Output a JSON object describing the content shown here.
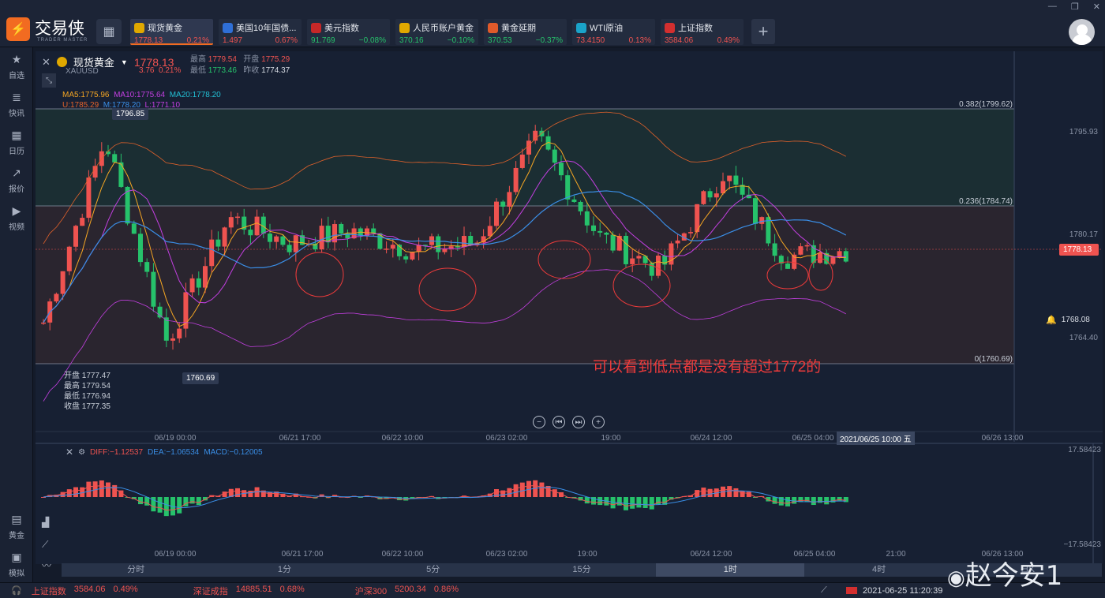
{
  "app": {
    "name": "交易侠",
    "sub": "TRADER MASTER"
  },
  "tickers": [
    {
      "name": "现货黄金",
      "price": "1778.13",
      "change": "0.21%",
      "icon": "gold-icon",
      "color": "#e0a800",
      "price_dir": "up",
      "chg_dir": "up"
    },
    {
      "name": "美国10年国债...",
      "price": "1.497",
      "change": "0.67%",
      "icon": "bond-icon",
      "color": "#2f6fd6",
      "price_dir": "up",
      "chg_dir": "up"
    },
    {
      "name": "美元指数",
      "price": "91.769",
      "change": "−0.08%",
      "icon": "us-flag-icon",
      "color": "#c62828",
      "price_dir": "dn",
      "chg_dir": "dn"
    },
    {
      "name": "人民币账户黄金",
      "price": "370.16",
      "change": "−0.10%",
      "icon": "gold-icon",
      "color": "#e0a800",
      "price_dir": "dn",
      "chg_dir": "dn"
    },
    {
      "name": "黄金延期",
      "price": "370.53",
      "change": "−0.37%",
      "icon": "gold-bar-icon",
      "color": "#e05a2a",
      "price_dir": "dn",
      "chg_dir": "dn"
    },
    {
      "name": "WTI原油",
      "price": "73.4150",
      "change": "0.13%",
      "icon": "oil-icon",
      "color": "#1aa3c9",
      "price_dir": "up",
      "chg_dir": "up"
    },
    {
      "name": "上证指数",
      "price": "3584.06",
      "change": "0.49%",
      "icon": "index-icon",
      "color": "#d32f2f",
      "price_dir": "up",
      "chg_dir": "up"
    }
  ],
  "sidebar": [
    {
      "label": "自选",
      "icon": "star-icon"
    },
    {
      "label": "快讯",
      "icon": "news-icon"
    },
    {
      "label": "日历",
      "icon": "calendar-icon"
    },
    {
      "label": "报价",
      "icon": "quote-icon"
    },
    {
      "label": "视频",
      "icon": "video-icon"
    }
  ],
  "sidebar_bottom": [
    {
      "label": "黄金",
      "icon": "gold-calc-icon"
    },
    {
      "label": "模拟",
      "icon": "wallet-icon"
    }
  ],
  "quote": {
    "name": "现货黄金",
    "code": "XAUUSD",
    "price": "1778.13",
    "chg": "3.76",
    "pct": "0.21%",
    "high_l": "最高",
    "high": "1779.54",
    "open_l": "开盘",
    "open": "1775.29",
    "low_l": "最低",
    "low": "1773.46",
    "prev_l": "昨收",
    "prev": "1774.37"
  },
  "ma": {
    "ma5": "MA5:1775.96",
    "ma10": "MA10:1775.64",
    "ma20": "MA20:1778.20",
    "u": "U:1785.29",
    "m": "M:1778.20",
    "l": "L:1771.10"
  },
  "ohlc_box": {
    "open": "开盘 1777.47",
    "high": "最高 1779.54",
    "low": "最低 1776.94",
    "close": "收盘 1777.35"
  },
  "tags": {
    "high_tag": "1796.85",
    "low_tag": "1760.69",
    "price_tag": "1778.13",
    "alert_tag": "1768.08"
  },
  "fib": [
    "0.382(1799.62)",
    "0.236(1784.74)",
    "0(1760.69)"
  ],
  "yaxis": [
    "1795.93",
    "1780.17",
    "1764.40"
  ],
  "xaxis": [
    "06/19 00:00",
    "06/21 17:00",
    "06/22 10:00",
    "06/23 02:00",
    "19:00",
    "06/24 12:00",
    "06/25 04:00",
    "06/26 13:00"
  ],
  "cursor_time": "2021/06/25 10:00 五",
  "macd": {
    "diff": "DIFF:−1.12537",
    "dea": "DEA:−1.06534",
    "macd": "MACD:−0.12005",
    "top": "17.58423",
    "bottom": "−17.58423"
  },
  "macd_xaxis": [
    "06/19 00:00",
    "06/21 17:00",
    "06/22 10:00",
    "06/23 02:00",
    "19:00",
    "06/24 12:00",
    "06/25 04:00",
    "21:00",
    "06/26 13:00"
  ],
  "periods": [
    "分时",
    "1分",
    "5分",
    "15分",
    "1时",
    "4时",
    "日K"
  ],
  "annotation": "可以看到低点都是没有超过1772的",
  "status": [
    {
      "name": "上证指数",
      "value": "3584.06",
      "pct": "0.49%"
    },
    {
      "name": "深证成指",
      "value": "14885.51",
      "pct": "0.68%"
    },
    {
      "name": "沪深300",
      "value": "5200.34",
      "pct": "0.86%"
    }
  ],
  "datetime": "2021-06-25 11:20:39",
  "watermark": "赵今安1",
  "chart_data": {
    "type": "candlestick",
    "x": [
      "06/19 00:00",
      "06/21 17:00",
      "06/22 10:00",
      "06/23 02:00",
      "19:00",
      "06/24 12:00",
      "06/25 04:00"
    ],
    "close": [
      1767,
      1795,
      1764,
      1783,
      1779,
      1781,
      1778,
      1779,
      1795,
      1780,
      1775,
      1790,
      1777,
      1778
    ],
    "colors": {
      "up": "#ef5350",
      "down": "#26c26b",
      "ma5": "#f5a623",
      "ma10": "#c23fe0",
      "ma20": "#3a8ee6",
      "boll": "#e0612b"
    }
  }
}
